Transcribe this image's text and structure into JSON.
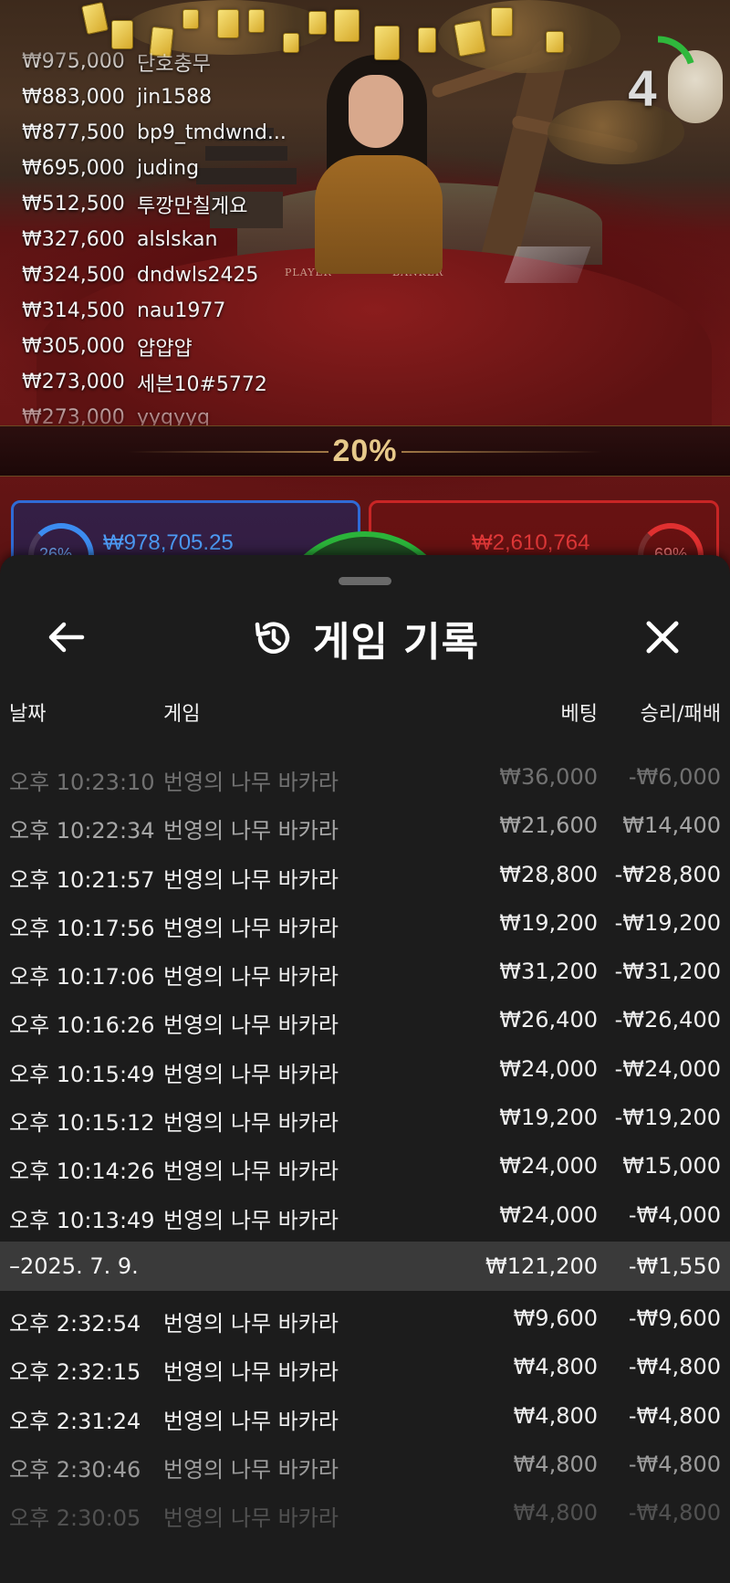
{
  "stream": {
    "leaderboard": [
      {
        "amount": "₩975,000",
        "name": "단호충무"
      },
      {
        "amount": "₩883,000",
        "name": "jin1588"
      },
      {
        "amount": "₩877,500",
        "name": "bp9_tmdwnd..."
      },
      {
        "amount": "₩695,000",
        "name": "juding"
      },
      {
        "amount": "₩512,500",
        "name": "투깡만칠게요"
      },
      {
        "amount": "₩327,600",
        "name": "alslskan"
      },
      {
        "amount": "₩324,500",
        "name": "dndwls2425"
      },
      {
        "amount": "₩314,500",
        "name": "nau1977"
      },
      {
        "amount": "₩305,000",
        "name": "얍얍얍"
      },
      {
        "amount": "₩273,000",
        "name": "세븐10#5772"
      },
      {
        "amount": "₩273,000",
        "name": "yyqyyq"
      }
    ],
    "countdown": "4",
    "countdown_fraction": 0.2,
    "countdown_color": "#2fb83c",
    "table_labels": {
      "player": "PLAYER",
      "banker": "BANKER"
    },
    "commission_percent": "20%",
    "player_panel": {
      "percent": "26%",
      "amount": "₩978,705.25",
      "color": "#3c8cf0",
      "fill_fraction": 0.26
    },
    "banker_panel": {
      "percent": "69%",
      "amount": "₩2,610,764",
      "color": "#e03030",
      "fill_fraction": 0.69
    },
    "tie_color": "#2bb43a"
  },
  "history": {
    "title": "게임 기록",
    "icons": {
      "back": "arrow-left-icon",
      "title": "history-clock-icon",
      "close": "close-icon"
    },
    "columns": {
      "date": "날짜",
      "game": "게임",
      "bet": "베팅",
      "win_loss": "승리/패배"
    },
    "groups": [
      {
        "rows": [
          {
            "time": "오후 10:23:10",
            "game": "번영의 나무 바카라",
            "bet": "₩36,000",
            "win_loss": "-₩6,000"
          },
          {
            "time": "오후 10:22:34",
            "game": "번영의 나무 바카라",
            "bet": "₩21,600",
            "win_loss": "₩14,400"
          },
          {
            "time": "오후 10:21:57",
            "game": "번영의 나무 바카라",
            "bet": "₩28,800",
            "win_loss": "-₩28,800"
          },
          {
            "time": "오후 10:17:56",
            "game": "번영의 나무 바카라",
            "bet": "₩19,200",
            "win_loss": "-₩19,200"
          },
          {
            "time": "오후 10:17:06",
            "game": "번영의 나무 바카라",
            "bet": "₩31,200",
            "win_loss": "-₩31,200"
          },
          {
            "time": "오후 10:16:26",
            "game": "번영의 나무 바카라",
            "bet": "₩26,400",
            "win_loss": "-₩26,400"
          },
          {
            "time": "오후 10:15:49",
            "game": "번영의 나무 바카라",
            "bet": "₩24,000",
            "win_loss": "-₩24,000"
          },
          {
            "time": "오후 10:15:12",
            "game": "번영의 나무 바카라",
            "bet": "₩19,200",
            "win_loss": "-₩19,200"
          },
          {
            "time": "오후 10:14:26",
            "game": "번영의 나무 바카라",
            "bet": "₩24,000",
            "win_loss": "₩15,000"
          },
          {
            "time": "오후 10:13:49",
            "game": "번영의 나무 바카라",
            "bet": "₩24,000",
            "win_loss": "-₩4,000"
          }
        ]
      }
    ],
    "day_summary": {
      "date": "–2025. 7. 9.",
      "bet": "₩121,200",
      "win_loss": "-₩1,550"
    },
    "day_rows": [
      {
        "time": "오후 2:32:54",
        "game": "번영의 나무 바카라",
        "bet": "₩9,600",
        "win_loss": "-₩9,600"
      },
      {
        "time": "오후 2:32:15",
        "game": "번영의 나무 바카라",
        "bet": "₩4,800",
        "win_loss": "-₩4,800"
      },
      {
        "time": "오후 2:31:24",
        "game": "번영의 나무 바카라",
        "bet": "₩4,800",
        "win_loss": "-₩4,800"
      },
      {
        "time": "오후 2:30:46",
        "game": "번영의 나무 바카라",
        "bet": "₩4,800",
        "win_loss": "-₩4,800"
      },
      {
        "time": "오후 2:30:05",
        "game": "번영의 나무 바카라",
        "bet": "₩4,800",
        "win_loss": "-₩4,800"
      }
    ]
  }
}
